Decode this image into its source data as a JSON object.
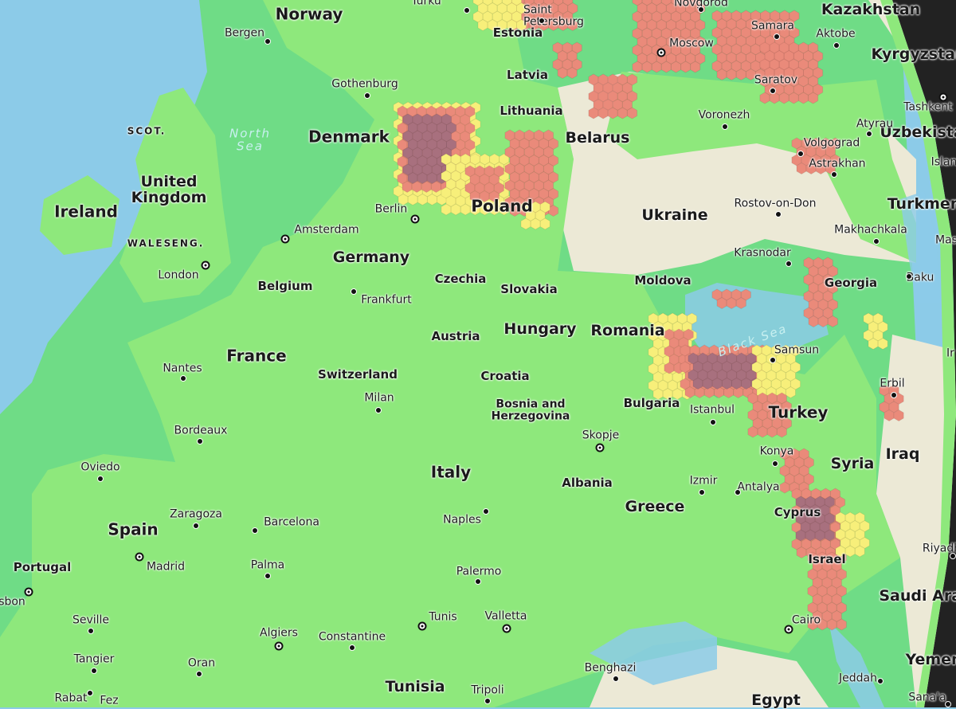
{
  "map": {
    "colors": {
      "ocean": "#8ccbe8",
      "hex_sea": "#6fdc86",
      "hex_land": "#8ee87c",
      "unhexed_land": "#ece9d6",
      "level_yellow": "#f7ef7a",
      "level_red": "#ea8a7a",
      "level_purple": "#a8707e",
      "space": "#222222"
    },
    "countries": [
      "Norway",
      "Estonia",
      "Latvia",
      "Lithuania",
      "Denmark",
      "Belarus",
      "Poland",
      "Ireland",
      "United Kingdom",
      "Germany",
      "Belgium",
      "Czechia",
      "Slovakia",
      "France",
      "Austria",
      "Hungary",
      "Romania",
      "Moldova",
      "Ukraine",
      "Switzerland",
      "Croatia",
      "Bosnia and Herzegovina",
      "Bulgaria",
      "Italy",
      "Albania",
      "Greece",
      "Turkey",
      "Syria",
      "Iraq",
      "Spain",
      "Portugal",
      "Cyprus",
      "Israel",
      "Tunisia",
      "Egypt",
      "Georgia",
      "Kazakhstan",
      "Kyrgyzstan",
      "Uzbekista",
      "Turkmen",
      "Saudi Arab",
      "Yemen"
    ],
    "regions": [
      "SCOT.",
      "WALES",
      "ENG."
    ],
    "seas": [
      "North Sea",
      "Black Sea"
    ],
    "cities": [
      "Bergen",
      "Turku",
      "Saint Petersburg",
      "Novgorod",
      "Moscow",
      "Samara",
      "Aktobe",
      "Gothenburg",
      "Saratov",
      "Tashkent",
      "Voronezh",
      "Atyrau",
      "Volgograd",
      "Astrakhan",
      "Berlin",
      "Amsterdam",
      "Rostov-on-Don",
      "Makhachkala",
      "London",
      "Krasnodar",
      "Baku",
      "Frankfurt",
      "Nantes",
      "Milan",
      "Samsun",
      "Erbil",
      "Istanbul",
      "Bordeaux",
      "Skopje",
      "Oviedo",
      "Konya",
      "Izmir",
      "Antalya",
      "Zaragoza",
      "Barcelona",
      "Naples",
      "Madrid",
      "Palma",
      "Palermo",
      "Riyadh",
      "sbon",
      "Seville",
      "Tunis",
      "Valletta",
      "Cairo",
      "Algiers",
      "Constantine",
      "Tangier",
      "Oran",
      "Benghazi",
      "Jeddah",
      "Rabat",
      "Fez",
      "Tripoli",
      "Sana'a",
      "Islan",
      "Mas",
      "Ir"
    ]
  }
}
